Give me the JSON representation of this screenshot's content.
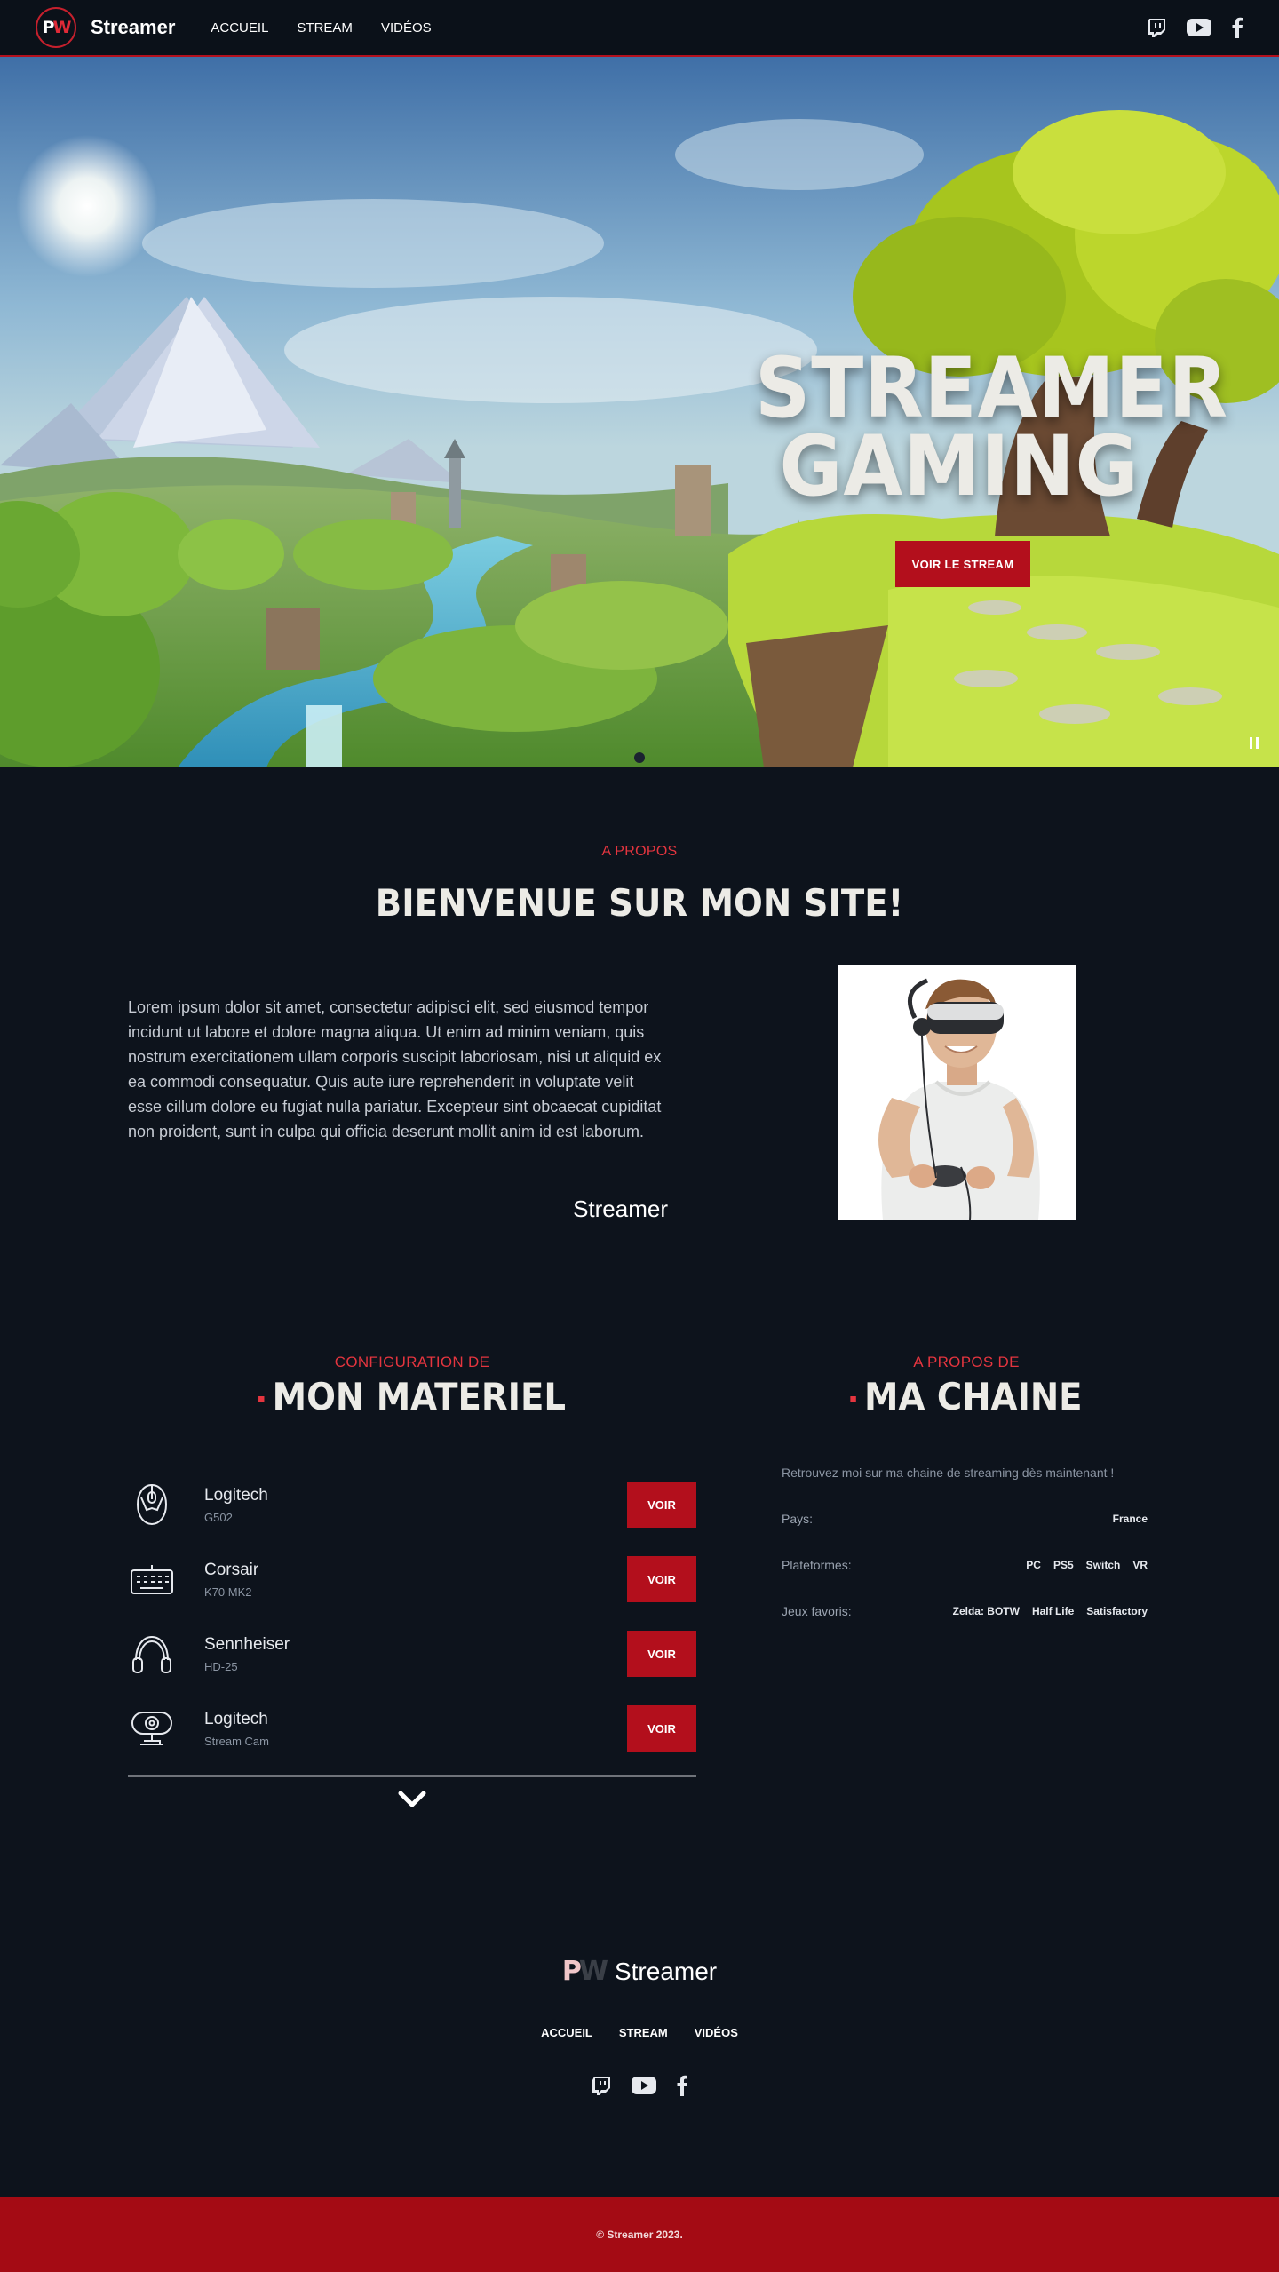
{
  "nav": {
    "logo_text_left": "P",
    "logo_text_right": "W",
    "brand": "Streamer",
    "links": [
      "ACCUEIL",
      "STREAM",
      "VIDÉOS"
    ],
    "social_icons": [
      "twitch-icon",
      "youtube-icon",
      "facebook-icon"
    ]
  },
  "hero": {
    "title_line1": "STREAMER",
    "title_line2": "GAMING",
    "button_label": "VOIR LE STREAM"
  },
  "about": {
    "eyebrow": "A PROPOS",
    "title": "BIENVENUE SUR MON SITE!",
    "text": "Lorem ipsum dolor sit amet, consectetur adipisci elit, sed eiusmod tempor incidunt ut labore et dolore magna aliqua. Ut enim ad minim veniam, quis nostrum exercitationem ullam corporis suscipit laboriosam, nisi ut aliquid ex ea commodi consequatur. Quis aute iure reprehenderit in voluptate velit esse cillum dolore eu fugiat nulla pariatur. Excepteur sint obcaecat cupiditat non proident, sunt in culpa qui officia deserunt mollit anim id est laborum.",
    "signature": "Streamer"
  },
  "gear": {
    "eyebrow": "CONFIGURATION DE",
    "title": "MON MATERIEL",
    "items": [
      {
        "name": "Logitech",
        "model": "G502",
        "button": "VOIR",
        "icon": "mouse-icon"
      },
      {
        "name": "Corsair",
        "model": "K70 MK2",
        "button": "VOIR",
        "icon": "keyboard-icon"
      },
      {
        "name": "Sennheiser",
        "model": "HD-25",
        "button": "VOIR",
        "icon": "headphones-icon"
      },
      {
        "name": "Logitech",
        "model": "Stream Cam",
        "button": "VOIR",
        "icon": "webcam-icon"
      }
    ]
  },
  "channel": {
    "eyebrow": "A PROPOS DE",
    "title": "MA CHAINE",
    "intro": "Retrouvez moi sur ma chaine de streaming dès maintenant !",
    "rows": [
      {
        "label": "Pays:",
        "values": [
          "France"
        ]
      },
      {
        "label": "Plateformes:",
        "values": [
          "PC",
          "PS5",
          "Switch",
          "VR"
        ]
      },
      {
        "label": "Jeux favoris:",
        "values": [
          "Zelda: BOTW",
          "Half Life",
          "Satisfactory"
        ]
      }
    ]
  },
  "footer": {
    "mark_left": "P",
    "mark_right": "W",
    "brand": "Streamer",
    "links": [
      "ACCUEIL",
      "STREAM",
      "VIDÉOS"
    ],
    "copyright": "© Streamer 2023."
  }
}
